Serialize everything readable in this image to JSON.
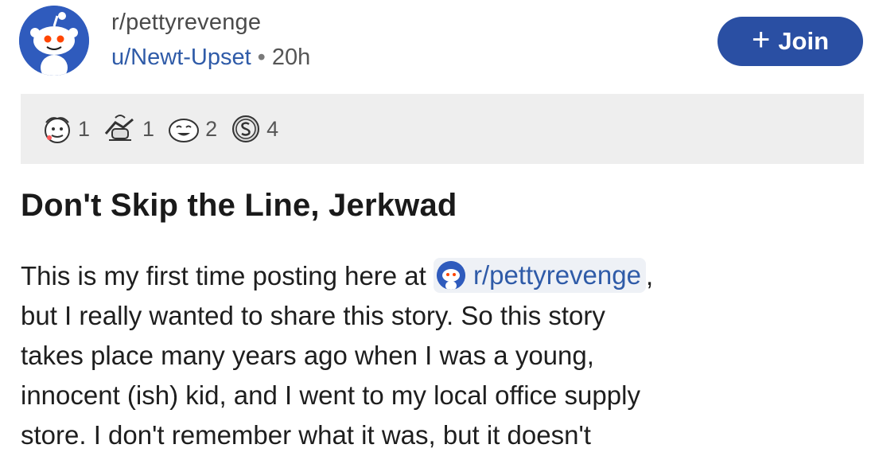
{
  "header": {
    "subreddit": "r/pettyrevenge",
    "username": "u/Newt-Upset",
    "separator": "•",
    "age": "20h",
    "join_plus": "+",
    "join_label": "Join"
  },
  "awards": [
    {
      "icon": "helpful-award-icon",
      "count": "1"
    },
    {
      "icon": "hand-shake-award-icon",
      "count": "1"
    },
    {
      "icon": "laughing-face-award-icon",
      "count": "2"
    },
    {
      "icon": "silver-coin-award-icon",
      "count": "4"
    }
  ],
  "post": {
    "title": "Don't Skip the Line, Jerkwad",
    "body": {
      "line1_prefix": "This is my first time posting here at",
      "subreddit_link": "r/pettyrevenge",
      "line1_suffix": ",",
      "line2": "but I really wanted to share this story. So this story",
      "line3": "takes place many years ago when I was a young,",
      "line4": "innocent (ish) kid, and I went to my local office supply",
      "line5": "store. I don't remember what it was, but it doesn't"
    }
  },
  "colors": {
    "join_button": "#2a4fa3",
    "link": "#2f5ba8",
    "awards_bar": "#eeeeee",
    "avatar_bg": "#2f5bbd"
  }
}
